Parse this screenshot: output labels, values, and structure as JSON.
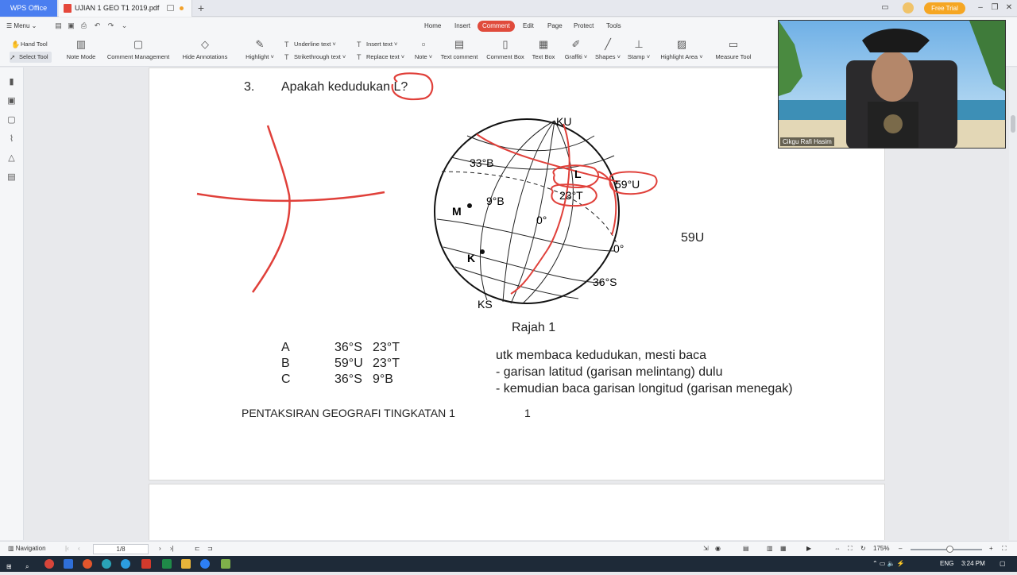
{
  "titlebar": {
    "app_tab": "WPS Office",
    "doc_tab": "UJIAN 1 GEO T1 2019.pdf",
    "new_tab": "+",
    "free_trial": "Free Trial"
  },
  "menubar": {
    "menu_label": "Menu",
    "tabs": [
      "Home",
      "Insert",
      "Comment",
      "Edit",
      "Page",
      "Protect",
      "Tools"
    ],
    "active_tab": "Comment"
  },
  "toolbar": {
    "hand_tool": "Hand Tool",
    "select_tool": "Select Tool",
    "note_mode": "Note Mode",
    "comment_management": "Comment Management",
    "hide_annotations": "Hide Annotations",
    "highlight": "Highlight",
    "underline_text": "Underline text",
    "strikethrough_text": "Strikethrough text",
    "insert_text": "Insert text",
    "replace_text": "Replace text",
    "note": "Note",
    "text_comment": "Text comment",
    "comment_box": "Comment Box",
    "text_box": "Text Box",
    "graffiti": "Graffiti",
    "shapes": "Shapes",
    "stamp": "Stamp",
    "highlight_area": "Highlight Area",
    "measure_tool": "Measure Tool"
  },
  "document": {
    "question_number": "3.",
    "question_text": "Apakah kedudukan L?",
    "figure": {
      "caption": "Rajah 1",
      "labels": {
        "ku": "KU",
        "ks": "KS",
        "lat33b": "33°B",
        "lon9b": "9°B",
        "lon0": "0°",
        "lat0": "0°",
        "lat36s": "36°S",
        "lat59u": "59°U",
        "lon23t": "23°T",
        "point_l": "L",
        "point_m": "M",
        "point_k": "K"
      }
    },
    "options": [
      {
        "letter": "A",
        "lat": "36°S",
        "lon": "23°T"
      },
      {
        "letter": "B",
        "lat": "59°U",
        "lon": "23°T"
      },
      {
        "letter": "C",
        "lat": "36°S",
        "lon": "9°B"
      }
    ],
    "annotation_answer": "59U",
    "notes": [
      "utk membaca kedudukan, mesti baca",
      "- garisan latitud (garisan melintang) dulu",
      "- kemudian baca garisan longitud (garisan menegak)"
    ],
    "footer_title": "PENTAKSIRAN GEOGRAFI TINGKATAN 1",
    "footer_page": "1"
  },
  "webcam": {
    "name": "Cikgu Rafi Hasim"
  },
  "statusbar": {
    "navigation": "Navigation",
    "page_indicator": "1/8",
    "zoom": "175%"
  },
  "taskbar": {
    "lang": "ENG",
    "time": "3:24 PM"
  },
  "colors": {
    "accent": "#4a7ef0",
    "active_tab": "#e04b3c",
    "annotation_red": "#e0403a",
    "free_trial": "#f5a623"
  }
}
